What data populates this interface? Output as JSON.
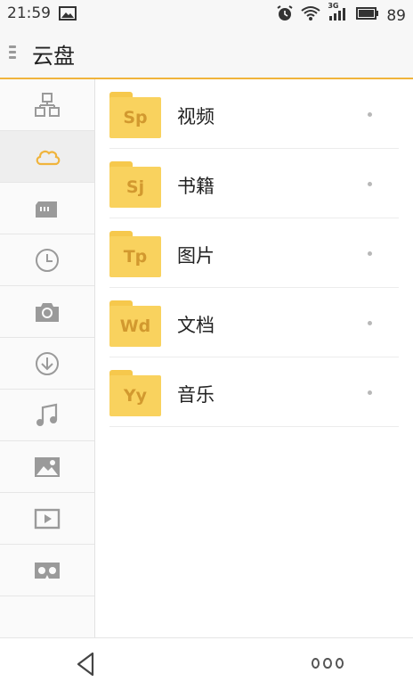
{
  "status_bar": {
    "time": "21:59",
    "battery": "89",
    "network": "3G"
  },
  "header": {
    "title": "云盘"
  },
  "sidebar": {
    "items": [
      {
        "name": "network-icon"
      },
      {
        "name": "cloud-icon",
        "active": true
      },
      {
        "name": "sd-card-icon"
      },
      {
        "name": "clock-icon"
      },
      {
        "name": "camera-icon"
      },
      {
        "name": "download-icon"
      },
      {
        "name": "music-icon"
      },
      {
        "name": "image-icon"
      },
      {
        "name": "video-icon"
      },
      {
        "name": "vr-glasses-icon"
      }
    ]
  },
  "folders": [
    {
      "abbr": "Sp",
      "label": "视频"
    },
    {
      "abbr": "Sj",
      "label": "书籍"
    },
    {
      "abbr": "Tp",
      "label": "图片"
    },
    {
      "abbr": "Wd",
      "label": "文档"
    },
    {
      "abbr": "Yy",
      "label": "音乐"
    }
  ],
  "colors": {
    "accent": "#f0b43c",
    "folder": "#f9d25e",
    "folder_text": "#d2992f",
    "icon_gray": "#9a9a9a"
  }
}
